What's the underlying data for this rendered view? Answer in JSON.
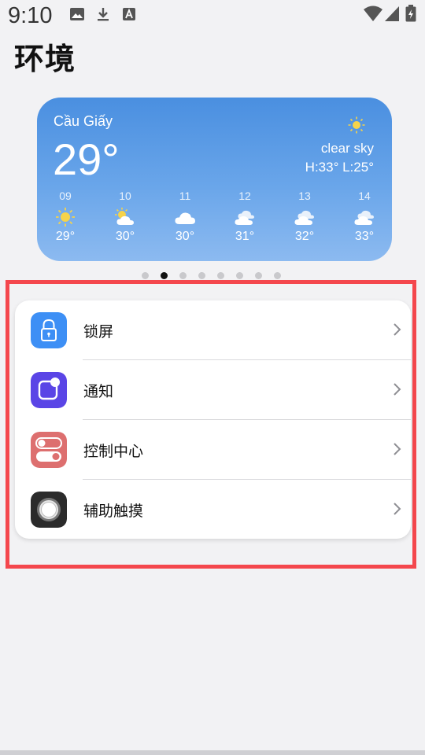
{
  "status_bar": {
    "time": "9:10",
    "left_icons": [
      "image-icon",
      "download-icon",
      "text-a-icon"
    ],
    "right_icons": [
      "wifi-icon",
      "cell-signal-icon",
      "battery-icon"
    ]
  },
  "page": {
    "title": "环境"
  },
  "weather": {
    "city": "Cầu Giấy",
    "temperature": "29°",
    "condition": "clear sky",
    "high_low": "H:33° L:25°",
    "hours": [
      {
        "hour": "09",
        "icon": "sun-icon",
        "temp": "29°"
      },
      {
        "hour": "10",
        "icon": "partly-cloudy-icon",
        "temp": "30°"
      },
      {
        "hour": "11",
        "icon": "cloud-icon",
        "temp": "30°"
      },
      {
        "hour": "12",
        "icon": "cloudy-icon",
        "temp": "31°"
      },
      {
        "hour": "13",
        "icon": "cloudy-icon",
        "temp": "32°"
      },
      {
        "hour": "14",
        "icon": "cloudy-icon",
        "temp": "33°"
      }
    ]
  },
  "pager": {
    "count": 8,
    "active_index": 1
  },
  "settings": {
    "items": [
      {
        "label": "锁屏",
        "icon": "lock-icon",
        "color": "#3d8ff5"
      },
      {
        "label": "通知",
        "icon": "notification-icon",
        "color": "#5a45e6"
      },
      {
        "label": "控制中心",
        "icon": "toggle-icon",
        "color": "#dd6f6f"
      },
      {
        "label": "辅助触摸",
        "icon": "assistive-touch-icon",
        "color": "#2b2b2b"
      }
    ]
  },
  "colors": {
    "highlight": "#f4474d",
    "weather_top": "#4a8fe0",
    "weather_bottom": "#8cbaf0"
  }
}
